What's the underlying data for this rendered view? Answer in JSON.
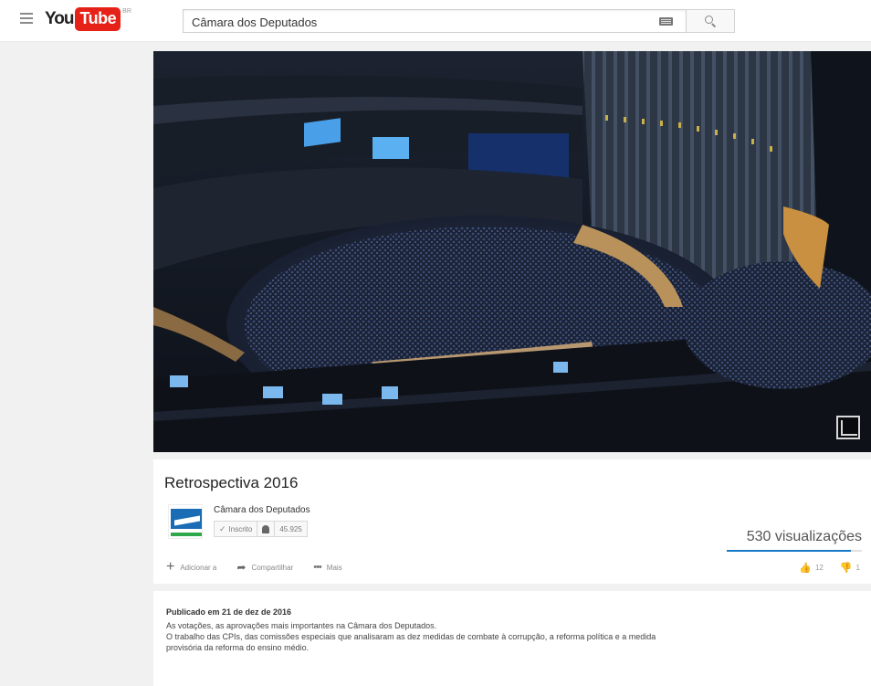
{
  "header": {
    "logo_you": "You",
    "logo_tube": "Tube",
    "logo_country": "BR",
    "search_value": "Câmara dos Deputados"
  },
  "video": {
    "title": "Retrospectiva 2016",
    "channel": {
      "name": "Câmara dos Deputados",
      "subscribed_label": "Inscrito",
      "subscriber_count": "45.925"
    },
    "views": "530 visualizações",
    "like_ratio": 0.92,
    "actions": {
      "add": "Adicionar a",
      "share": "Compartilhar",
      "more": "Mais"
    },
    "likes": "12",
    "dislikes": "1"
  },
  "description": {
    "published": "Publicado em 21 de dez de 2016",
    "lines": [
      "As votações, as aprovações mais importantes na Câmara dos Deputados.",
      "O trabalho das CPIs, das comissões especiais que analisaram as dez medidas de combate à corrupção, a reforma política e a medida",
      "provisória da reforma do ensino médio."
    ]
  },
  "colors": {
    "brand_red": "#e62117",
    "accent_blue": "#167ac6",
    "channel_blue": "#1a6db5",
    "channel_green": "#2ea84a"
  }
}
